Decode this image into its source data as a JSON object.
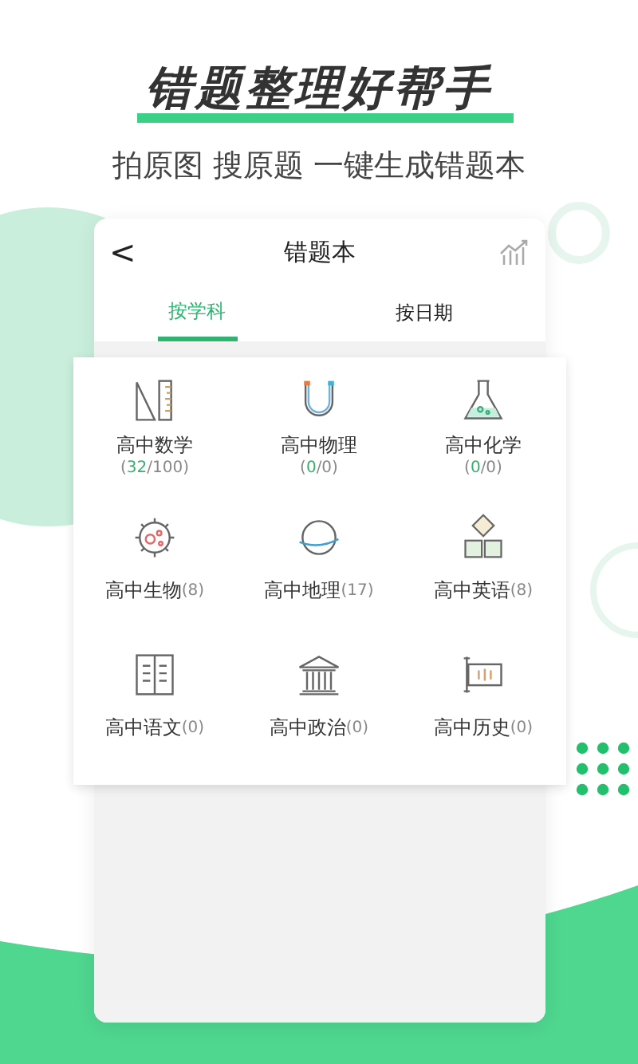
{
  "headline": "错题整理好帮手",
  "subtitle": "拍原图 搜原题 一键生成错题本",
  "card": {
    "back": "<",
    "title": "错题本"
  },
  "tabs": [
    {
      "label": "按学科",
      "selected": true
    },
    {
      "label": "按日期",
      "selected": false
    }
  ],
  "subjects": [
    {
      "kind": "stacked",
      "name": "高中数学",
      "count": [
        {
          "text": "(",
          "highlight": false
        },
        {
          "text": "32",
          "highlight": true
        },
        {
          "text": "/100)",
          "highlight": false
        }
      ]
    },
    {
      "kind": "stacked",
      "name": "高中物理",
      "count": [
        {
          "text": "(",
          "highlight": false
        },
        {
          "text": "0",
          "highlight": true
        },
        {
          "text": "/0)",
          "highlight": false
        }
      ]
    },
    {
      "kind": "stacked",
      "name": "高中化学",
      "count": [
        {
          "text": "(",
          "highlight": false
        },
        {
          "text": "0",
          "highlight": true
        },
        {
          "text": "/0)",
          "highlight": false
        }
      ]
    },
    {
      "kind": "inline",
      "name": "高中生物",
      "count": [
        {
          "text": "(8)",
          "highlight": false
        }
      ]
    },
    {
      "kind": "inline",
      "name": "高中地理",
      "count": [
        {
          "text": "(17)",
          "highlight": false
        }
      ]
    },
    {
      "kind": "inline",
      "name": "高中英语",
      "count": [
        {
          "text": "(8)",
          "highlight": false
        }
      ]
    },
    {
      "kind": "inline",
      "name": "高中语文",
      "count": [
        {
          "text": "(0)",
          "highlight": false
        }
      ]
    },
    {
      "kind": "inline",
      "name": "高中政治",
      "count": [
        {
          "text": "(0)",
          "highlight": false
        }
      ]
    },
    {
      "kind": "inline",
      "name": "高中历史",
      "count": [
        {
          "text": "(0)",
          "highlight": false
        }
      ]
    }
  ]
}
